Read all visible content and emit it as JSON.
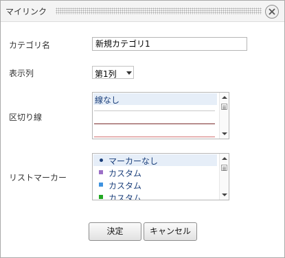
{
  "dialog": {
    "title": "マイリンク",
    "close_icon": "close-icon"
  },
  "fields": {
    "category_name_label": "カテゴリ名",
    "category_name_value": "新規カテゴリ1",
    "display_column_label": "表示列",
    "display_column_value": "第1列",
    "divider_label": "区切り線",
    "divider_options": [
      {
        "label": "線なし",
        "selected": true
      },
      {
        "label": "",
        "line_color": "#c8c8c8"
      },
      {
        "label": "",
        "line_color": "#7a2b2b"
      },
      {
        "label": "",
        "line_color": "#d27070"
      }
    ],
    "list_marker_label": "リストマーカー",
    "list_marker_options": [
      {
        "label": "マーカーなし",
        "marker": "dot",
        "color": "#1a3e7a",
        "selected": true
      },
      {
        "label": "カスタム",
        "marker": "square",
        "color": "#9b6fc6"
      },
      {
        "label": "カスタム",
        "marker": "square",
        "color": "#3f93e0"
      },
      {
        "label": "カスタム",
        "marker": "square",
        "color": "#22a822"
      }
    ]
  },
  "buttons": {
    "ok_label": "決定",
    "cancel_label": "キャンセル"
  }
}
